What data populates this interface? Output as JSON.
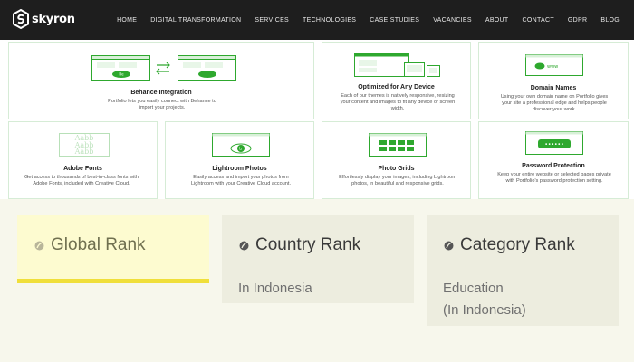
{
  "brand": {
    "name": "skyron"
  },
  "nav": [
    "HOME",
    "DIGITAL TRANSFORMATION",
    "SERVICES",
    "TECHNOLOGIES",
    "CASE STUDIES",
    "VACANCIES",
    "ABOUT",
    "CONTACT",
    "GDPR",
    "BLOG"
  ],
  "features": {
    "behance": {
      "title": "Behance Integration",
      "desc": "Portfolio lets you easily connect with Behance to import your projects.",
      "badge": "Be"
    },
    "device": {
      "title": "Optimized for Any Device",
      "desc": "Each of our themes is natively responsive, resizing your content and images to fit any device or screen width."
    },
    "domain": {
      "title": "Domain Names",
      "desc": "Using your own domain name on Portfolio gives your site a professional edge and helps people discover your work.",
      "url": "www"
    },
    "fonts": {
      "title": "Adobe Fonts",
      "desc": "Get access to thousands of best-in-class fonts with Adobe Fonts, included with Creative Cloud.",
      "sample": [
        "Aabb",
        "Aabb",
        "Aabb"
      ]
    },
    "lightroom": {
      "title": "Lightroom Photos",
      "desc": "Easily access and import your photos from Lightroom with your Creative Cloud account.",
      "badge": "Lr"
    },
    "grids": {
      "title": "Photo Grids",
      "desc": "Effortlessly display your images, including Lightroom photos, in beautiful and responsive grids."
    },
    "password": {
      "title": "Password Protection",
      "desc": "Keep your entire website or selected pages private with Portfolio's password protection setting.",
      "mask": "••••••"
    }
  },
  "ranks": {
    "global": {
      "title": "Global Rank"
    },
    "country": {
      "title": "Country Rank",
      "sub": "In Indonesia"
    },
    "category": {
      "title": "Category Rank",
      "sub1": "Education",
      "sub2": "(In Indonesia)"
    }
  },
  "colors": {
    "accent_green": "#2ea82e",
    "nav_bg": "#1e1e1e",
    "highlight_yellow": "#f0df3a"
  }
}
